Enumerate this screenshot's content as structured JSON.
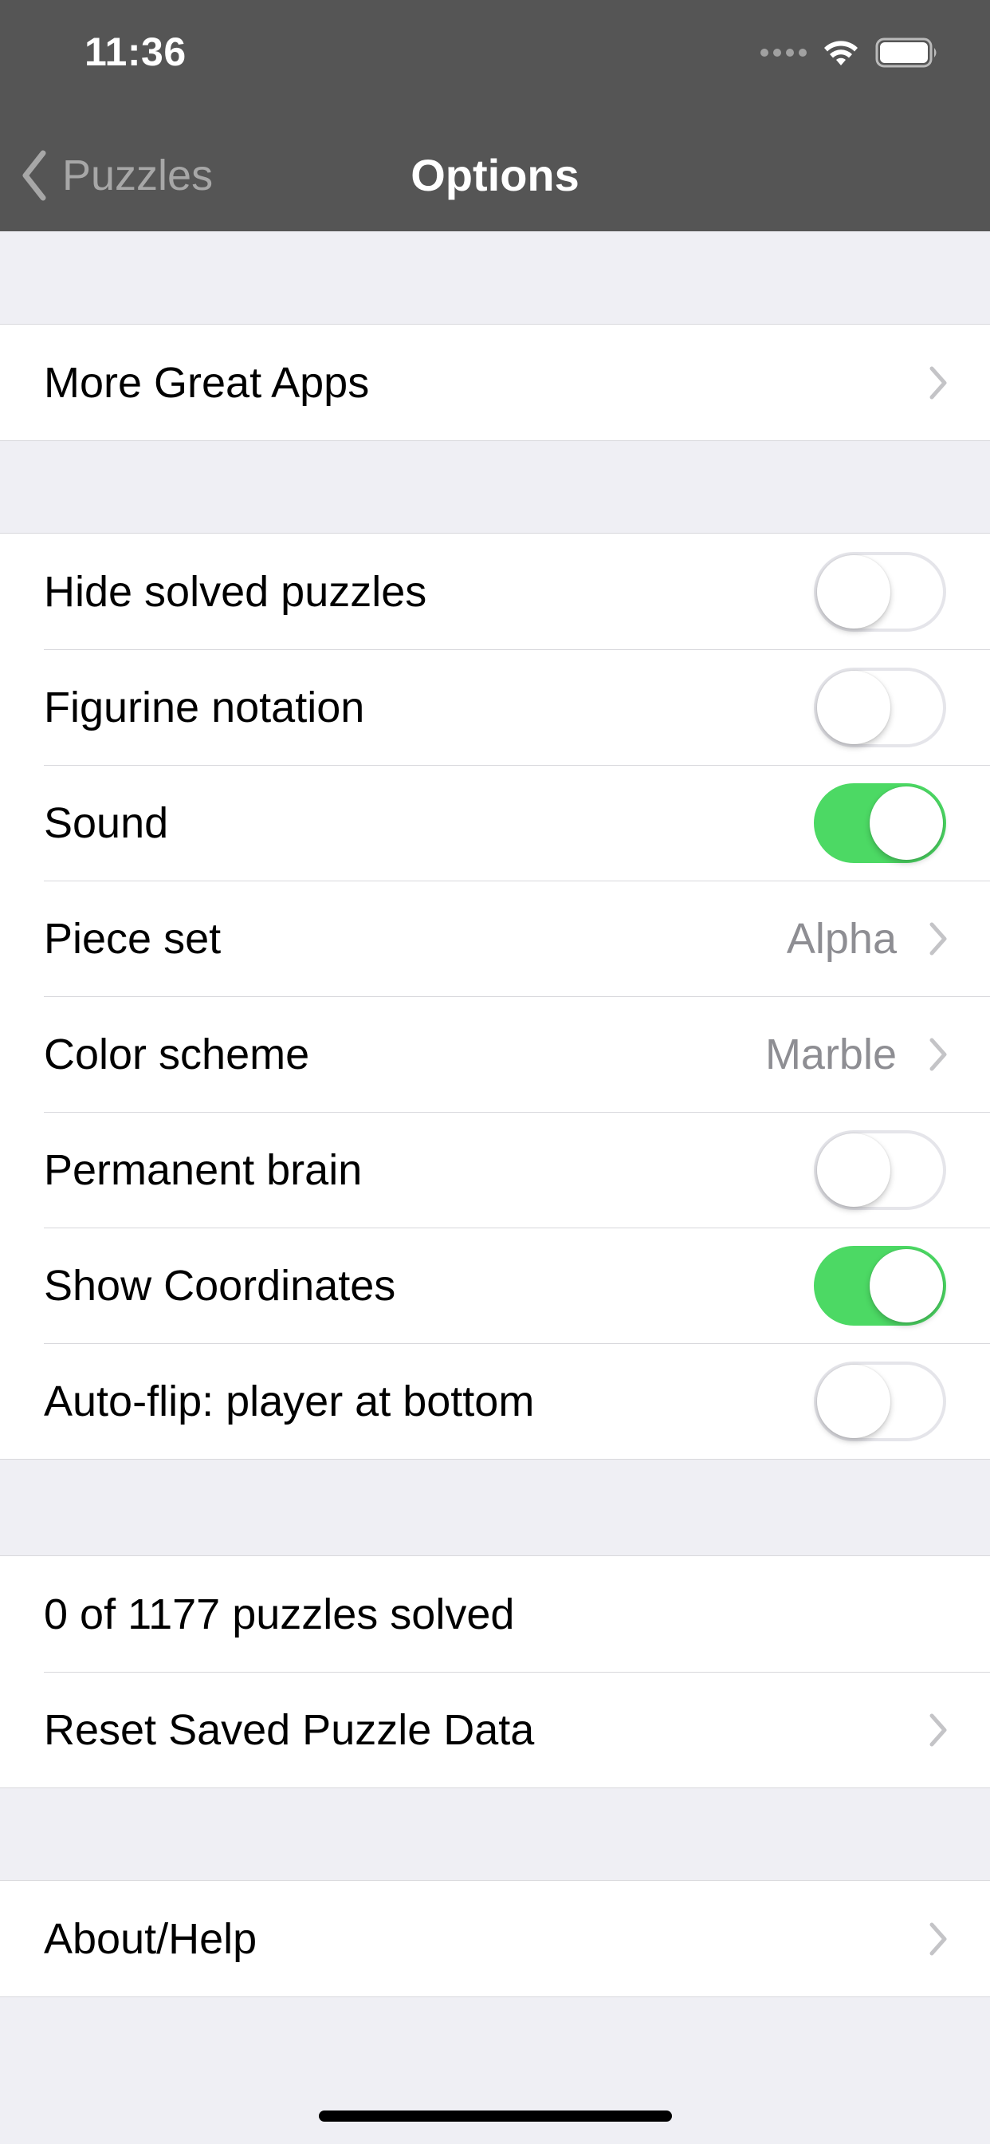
{
  "status_bar": {
    "time": "11:36"
  },
  "nav": {
    "back_label": "Puzzles",
    "title": "Options"
  },
  "sections": {
    "apps": {
      "more_great_apps": "More Great Apps"
    },
    "settings": {
      "hide_solved": {
        "label": "Hide solved puzzles",
        "on": false
      },
      "figurine": {
        "label": "Figurine notation",
        "on": false
      },
      "sound": {
        "label": "Sound",
        "on": true
      },
      "piece_set": {
        "label": "Piece set",
        "value": "Alpha"
      },
      "color_scheme": {
        "label": "Color scheme",
        "value": "Marble"
      },
      "permanent_brain": {
        "label": "Permanent brain",
        "on": false
      },
      "show_coordinates": {
        "label": "Show Coordinates",
        "on": true
      },
      "auto_flip": {
        "label": "Auto-flip: player at bottom",
        "on": false
      }
    },
    "data": {
      "solved_count": "0 of 1177 puzzles solved",
      "reset": "Reset Saved Puzzle Data"
    },
    "about": {
      "about_help": "About/Help"
    }
  },
  "colors": {
    "nav_background": "#555555",
    "switch_on": "#4cd964",
    "page_background": "#efeff4",
    "secondary_text": "#8e8e93"
  }
}
